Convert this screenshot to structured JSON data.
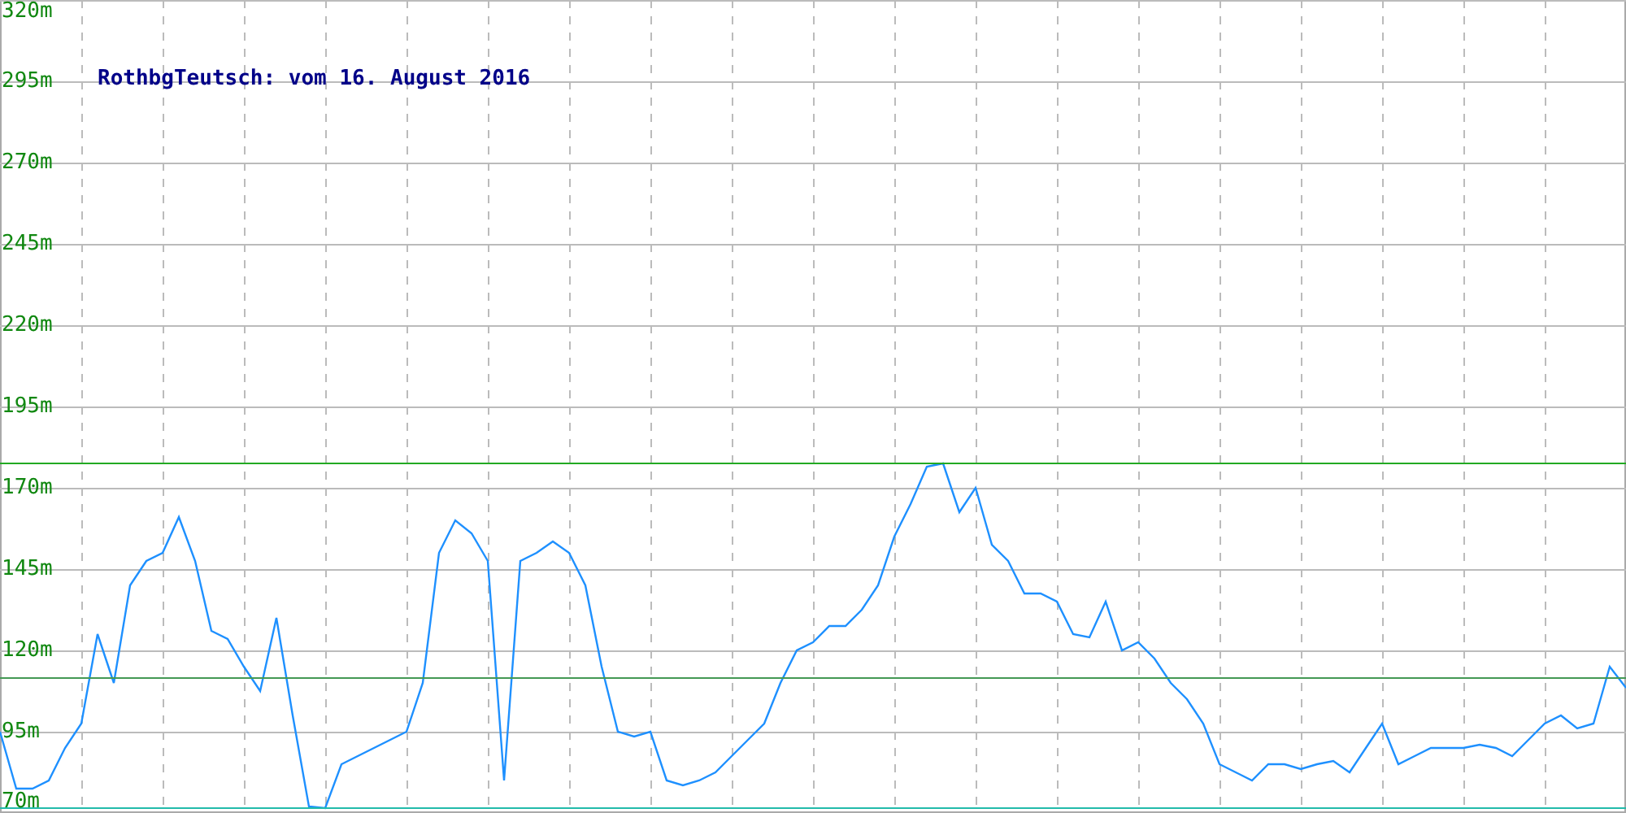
{
  "chart_data": {
    "type": "line",
    "title": "RothbgTeutsch: vom 16. August 2016",
    "ylim": [
      70,
      320
    ],
    "grid": true,
    "yticks": [
      {
        "value": 70,
        "label": "70m"
      },
      {
        "value": 95,
        "label": "95m"
      },
      {
        "value": 120,
        "label": "120m"
      },
      {
        "value": 145,
        "label": "145m"
      },
      {
        "value": 170,
        "label": "170m"
      },
      {
        "value": 195,
        "label": "195m"
      },
      {
        "value": 220,
        "label": "220m"
      },
      {
        "value": 245,
        "label": "245m"
      },
      {
        "value": 270,
        "label": "270m"
      },
      {
        "value": 295,
        "label": "295m"
      },
      {
        "value": 320,
        "label": "320m"
      }
    ],
    "categories": [
      null,
      null,
      null,
      null,
      null,
      null,
      null,
      null,
      null,
      null,
      null,
      null,
      null,
      null,
      null,
      null,
      null,
      null,
      null,
      null,
      null,
      null,
      null,
      null,
      null,
      null,
      null,
      null,
      null,
      null,
      null,
      null,
      null,
      null,
      null,
      null,
      null,
      null,
      null,
      null,
      null,
      null,
      null,
      null,
      null,
      null,
      null,
      null,
      null,
      null,
      null,
      null,
      null,
      null,
      null,
      null,
      null,
      null,
      null,
      null,
      null,
      null,
      null,
      null,
      null,
      null,
      null,
      null,
      null,
      null,
      null,
      null,
      null,
      null,
      null,
      null,
      null,
      null,
      null,
      null,
      null,
      null,
      null,
      null,
      null,
      null,
      null,
      null,
      null,
      null,
      null,
      null,
      null,
      null,
      null,
      null,
      null,
      null,
      null,
      null,
      null
    ],
    "series": [
      {
        "color": "#1e90ff",
        "values": [
          95,
          77.5,
          77.5,
          80,
          90,
          97.5,
          125,
          110,
          140,
          147.5,
          150,
          161,
          147.5,
          126,
          123.5,
          115,
          107.5,
          130,
          100,
          72,
          71.5,
          85,
          87.5,
          90,
          92.5,
          95,
          110,
          150,
          160,
          156,
          147.5,
          80,
          147.5,
          150,
          153.5,
          150,
          140,
          115,
          95,
          93.5,
          95,
          80,
          78.5,
          80,
          82.5,
          87.5,
          92.5,
          97.5,
          110,
          120,
          122.5,
          127.5,
          127.5,
          132.5,
          140,
          155,
          165,
          176.5,
          177.5,
          162.5,
          170,
          152.5,
          147.5,
          137.5,
          137.5,
          135,
          125,
          124,
          135,
          120,
          122.5,
          117.5,
          110,
          105,
          97.5,
          85,
          82.5,
          80,
          85,
          85,
          83.5,
          85,
          86,
          82.5,
          90,
          97.5,
          85,
          87.5,
          90,
          90,
          90,
          91,
          90,
          87.5,
          92.5,
          97.5,
          100,
          96,
          97.5,
          115,
          108.5
        ]
      },
      {
        "color": "#22aa22",
        "values": [
          177.5,
          177.5,
          177.5,
          177.5,
          177.5,
          177.5,
          177.5,
          177.5,
          177.5,
          177.5,
          177.5,
          177.5,
          177.5,
          177.5,
          177.5,
          177.5,
          177.5,
          177.5,
          177.5,
          177.5,
          177.5,
          177.5,
          177.5,
          177.5,
          177.5,
          177.5,
          177.5,
          177.5,
          177.5,
          177.5,
          177.5,
          177.5,
          177.5,
          177.5,
          177.5,
          177.5,
          177.5,
          177.5,
          177.5,
          177.5,
          177.5,
          177.5,
          177.5,
          177.5,
          177.5,
          177.5,
          177.5,
          177.5,
          177.5,
          177.5,
          177.5,
          177.5,
          177.5,
          177.5,
          177.5,
          177.5,
          177.5,
          177.5,
          177.5,
          177.5,
          177.5,
          177.5,
          177.5,
          177.5,
          177.5,
          177.5,
          177.5,
          177.5,
          177.5,
          177.5,
          177.5,
          177.5,
          177.5,
          177.5,
          177.5,
          177.5,
          177.5,
          177.5,
          177.5,
          177.5,
          177.5,
          177.5,
          177.5,
          177.5,
          177.5,
          177.5,
          177.5,
          177.5,
          177.5,
          177.5,
          177.5,
          177.5,
          177.5,
          177.5,
          177.5,
          177.5,
          177.5,
          177.5,
          177.5,
          177.5,
          177.5
        ]
      },
      {
        "color": "#449955",
        "values": [
          111.5,
          111.5,
          111.5,
          111.5,
          111.5,
          111.5,
          111.5,
          111.5,
          111.5,
          111.5,
          111.5,
          111.5,
          111.5,
          111.5,
          111.5,
          111.5,
          111.5,
          111.5,
          111.5,
          111.5,
          111.5,
          111.5,
          111.5,
          111.5,
          111.5,
          111.5,
          111.5,
          111.5,
          111.5,
          111.5,
          111.5,
          111.5,
          111.5,
          111.5,
          111.5,
          111.5,
          111.5,
          111.5,
          111.5,
          111.5,
          111.5,
          111.5,
          111.5,
          111.5,
          111.5,
          111.5,
          111.5,
          111.5,
          111.5,
          111.5,
          111.5,
          111.5,
          111.5,
          111.5,
          111.5,
          111.5,
          111.5,
          111.5,
          111.5,
          111.5,
          111.5,
          111.5,
          111.5,
          111.5,
          111.5,
          111.5,
          111.5,
          111.5,
          111.5,
          111.5,
          111.5,
          111.5,
          111.5,
          111.5,
          111.5,
          111.5,
          111.5,
          111.5,
          111.5,
          111.5,
          111.5,
          111.5,
          111.5,
          111.5,
          111.5,
          111.5,
          111.5,
          111.5,
          111.5,
          111.5,
          111.5,
          111.5,
          111.5,
          111.5,
          111.5,
          111.5,
          111.5,
          111.5,
          111.5,
          111.5,
          111.5
        ]
      },
      {
        "color": "#22bbaa",
        "values": [
          71.5,
          71.5,
          71.5,
          71.5,
          71.5,
          71.5,
          71.5,
          71.5,
          71.5,
          71.5,
          71.5,
          71.5,
          71.5,
          71.5,
          71.5,
          71.5,
          71.5,
          71.5,
          71.5,
          71.5,
          71.5,
          71.5,
          71.5,
          71.5,
          71.5,
          71.5,
          71.5,
          71.5,
          71.5,
          71.5,
          71.5,
          71.5,
          71.5,
          71.5,
          71.5,
          71.5,
          71.5,
          71.5,
          71.5,
          71.5,
          71.5,
          71.5,
          71.5,
          71.5,
          71.5,
          71.5,
          71.5,
          71.5,
          71.5,
          71.5,
          71.5,
          71.5,
          71.5,
          71.5,
          71.5,
          71.5,
          71.5,
          71.5,
          71.5,
          71.5,
          71.5,
          71.5,
          71.5,
          71.5,
          71.5,
          71.5,
          71.5,
          71.5,
          71.5,
          71.5,
          71.5,
          71.5,
          71.5,
          71.5,
          71.5,
          71.5,
          71.5,
          71.5,
          71.5,
          71.5,
          71.5,
          71.5,
          71.5,
          71.5,
          71.5,
          71.5,
          71.5,
          71.5,
          71.5,
          71.5,
          71.5,
          71.5,
          71.5,
          71.5,
          71.5,
          71.5,
          71.5,
          71.5,
          71.5,
          71.5,
          71.5
        ]
      }
    ]
  }
}
